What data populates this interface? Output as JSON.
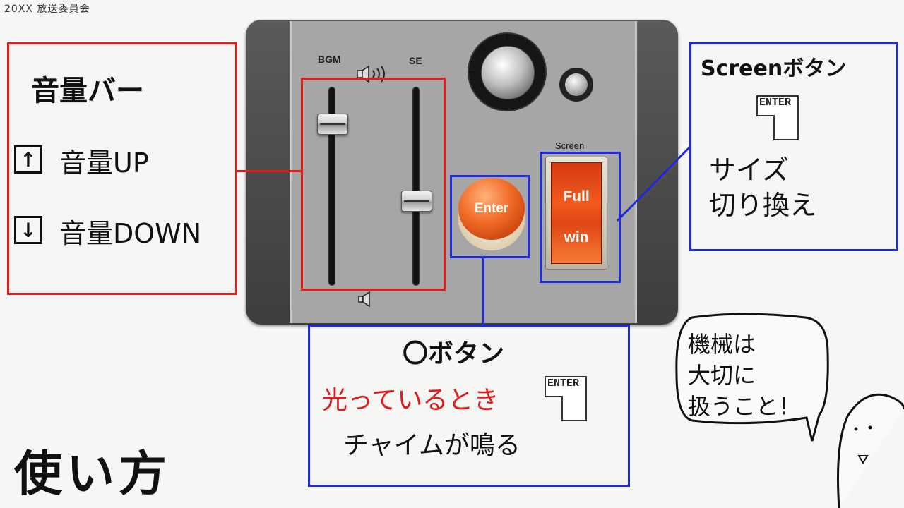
{
  "header": {
    "text": "20XX 放送委員会"
  },
  "device": {
    "slider_bgm_label": "BGM",
    "slider_se_label": "SE",
    "bgm_level": 0.85,
    "se_level": 0.42,
    "enter_button_label": "Enter",
    "screen_switch_label": "Screen",
    "rocker_full_label": "Full",
    "rocker_win_label": "win",
    "accent_orange": "#f06a26"
  },
  "callouts": {
    "volume": {
      "title": "音量バー",
      "up_key": "↑",
      "up_text": "音量UP",
      "down_key": "↓",
      "down_text": "音量DOWN"
    },
    "screen": {
      "title": "Screenボタン",
      "key_label": "ENTER",
      "desc_line1": "サイズ",
      "desc_line2": "切り換え"
    },
    "o_button": {
      "title": "〇ボタン",
      "condition": "光っているとき",
      "key_label": "ENTER",
      "result": "チャイムが鳴る"
    }
  },
  "usage_title": "使い方",
  "speech_bubble": {
    "line1": "機械は",
    "line2": "大切に",
    "line3": "扱うこと！"
  },
  "colors": {
    "red": "#e31b1b",
    "blue": "#1f2bdc"
  }
}
